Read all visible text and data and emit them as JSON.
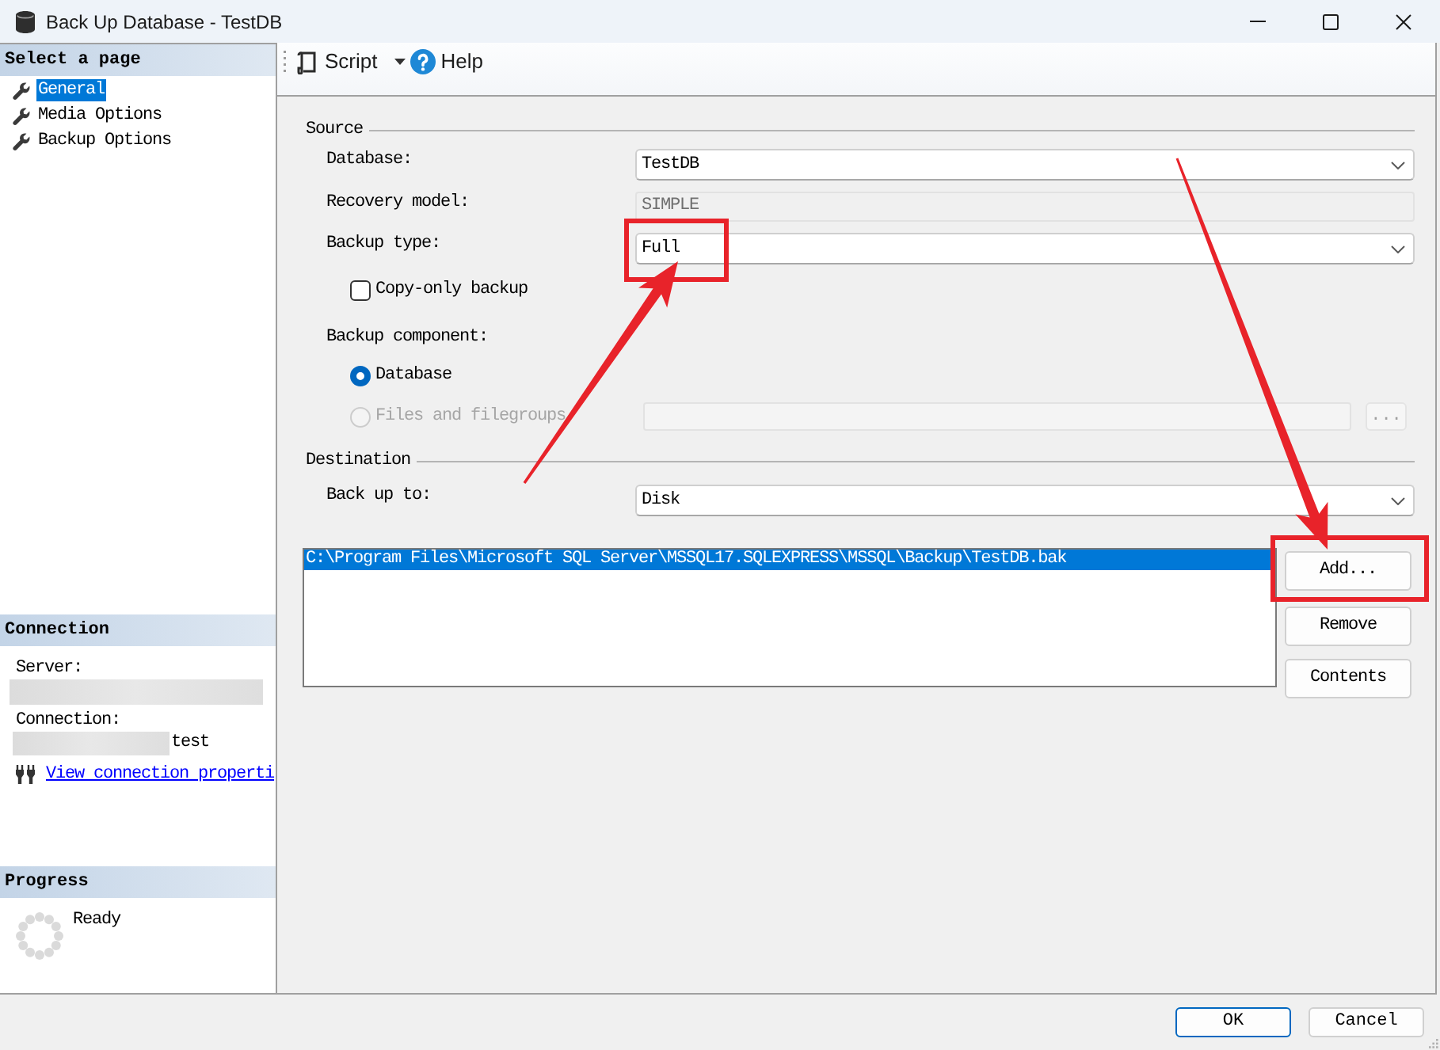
{
  "window": {
    "title": "Back Up Database - TestDB"
  },
  "sidebar": {
    "pages_heading": "Select a page",
    "pages": [
      {
        "label": "General",
        "selected": true
      },
      {
        "label": "Media Options",
        "selected": false
      },
      {
        "label": "Backup Options",
        "selected": false
      }
    ],
    "connection": {
      "heading": "Connection",
      "server_label": "Server:",
      "server_redacted": true,
      "connection_label": "Connection:",
      "connection_redacted": true,
      "connection_value": "test",
      "link": "View connection properti"
    },
    "progress": {
      "heading": "Progress",
      "status": "Ready"
    }
  },
  "toolbar": {
    "script": "Script",
    "help": "Help"
  },
  "source": {
    "heading": "Source",
    "database": {
      "label": "Database:",
      "value": "TestDB"
    },
    "recovery_model": {
      "label": "Recovery model:",
      "value": "SIMPLE",
      "disabled": true
    },
    "backup_type": {
      "label": "Backup type:",
      "value": "Full",
      "annotated": true
    },
    "copy_only": {
      "label": "Copy-only backup",
      "checked": false
    },
    "component_label": "Backup component:",
    "components": [
      {
        "label": "Database",
        "selected": true,
        "disabled": false
      },
      {
        "label": "Files and filegroups",
        "selected": false,
        "disabled": true
      }
    ],
    "filegroups_field": {
      "disabled": true
    },
    "browse_button": {
      "label": "...",
      "disabled": true
    }
  },
  "destination": {
    "heading": "Destination",
    "back_up_to": {
      "label": "Back up to:",
      "value": "Disk"
    },
    "files": [
      {
        "path": "C:\\Program Files\\Microsoft SQL Server\\MSSQL17.SQLEXPRESS\\MSSQL\\Backup\\TestDB.bak",
        "selected": true
      }
    ],
    "buttons": [
      {
        "label": "Add...",
        "annotated": true
      },
      {
        "label": "Remove"
      },
      {
        "label": "Contents"
      }
    ]
  },
  "buttons": [
    {
      "label": "OK",
      "default": true
    },
    {
      "label": "Cancel",
      "default": false
    }
  ]
}
